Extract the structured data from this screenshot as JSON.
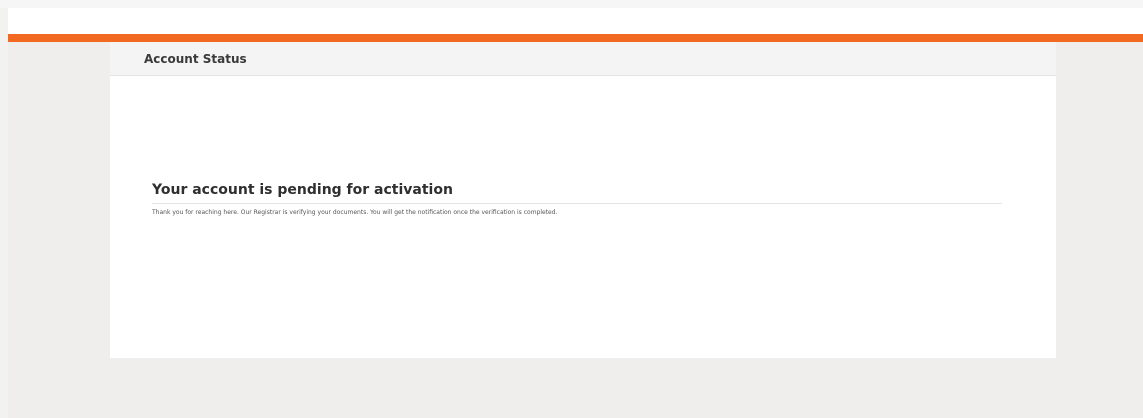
{
  "header": {
    "accent_color": "#f26a22"
  },
  "card": {
    "title": "Account Status",
    "heading": "Your account is pending for activation",
    "message": "Thank you for reaching here. Our Registrar is verifying your documents. You will get the notification once the verification is completed."
  }
}
